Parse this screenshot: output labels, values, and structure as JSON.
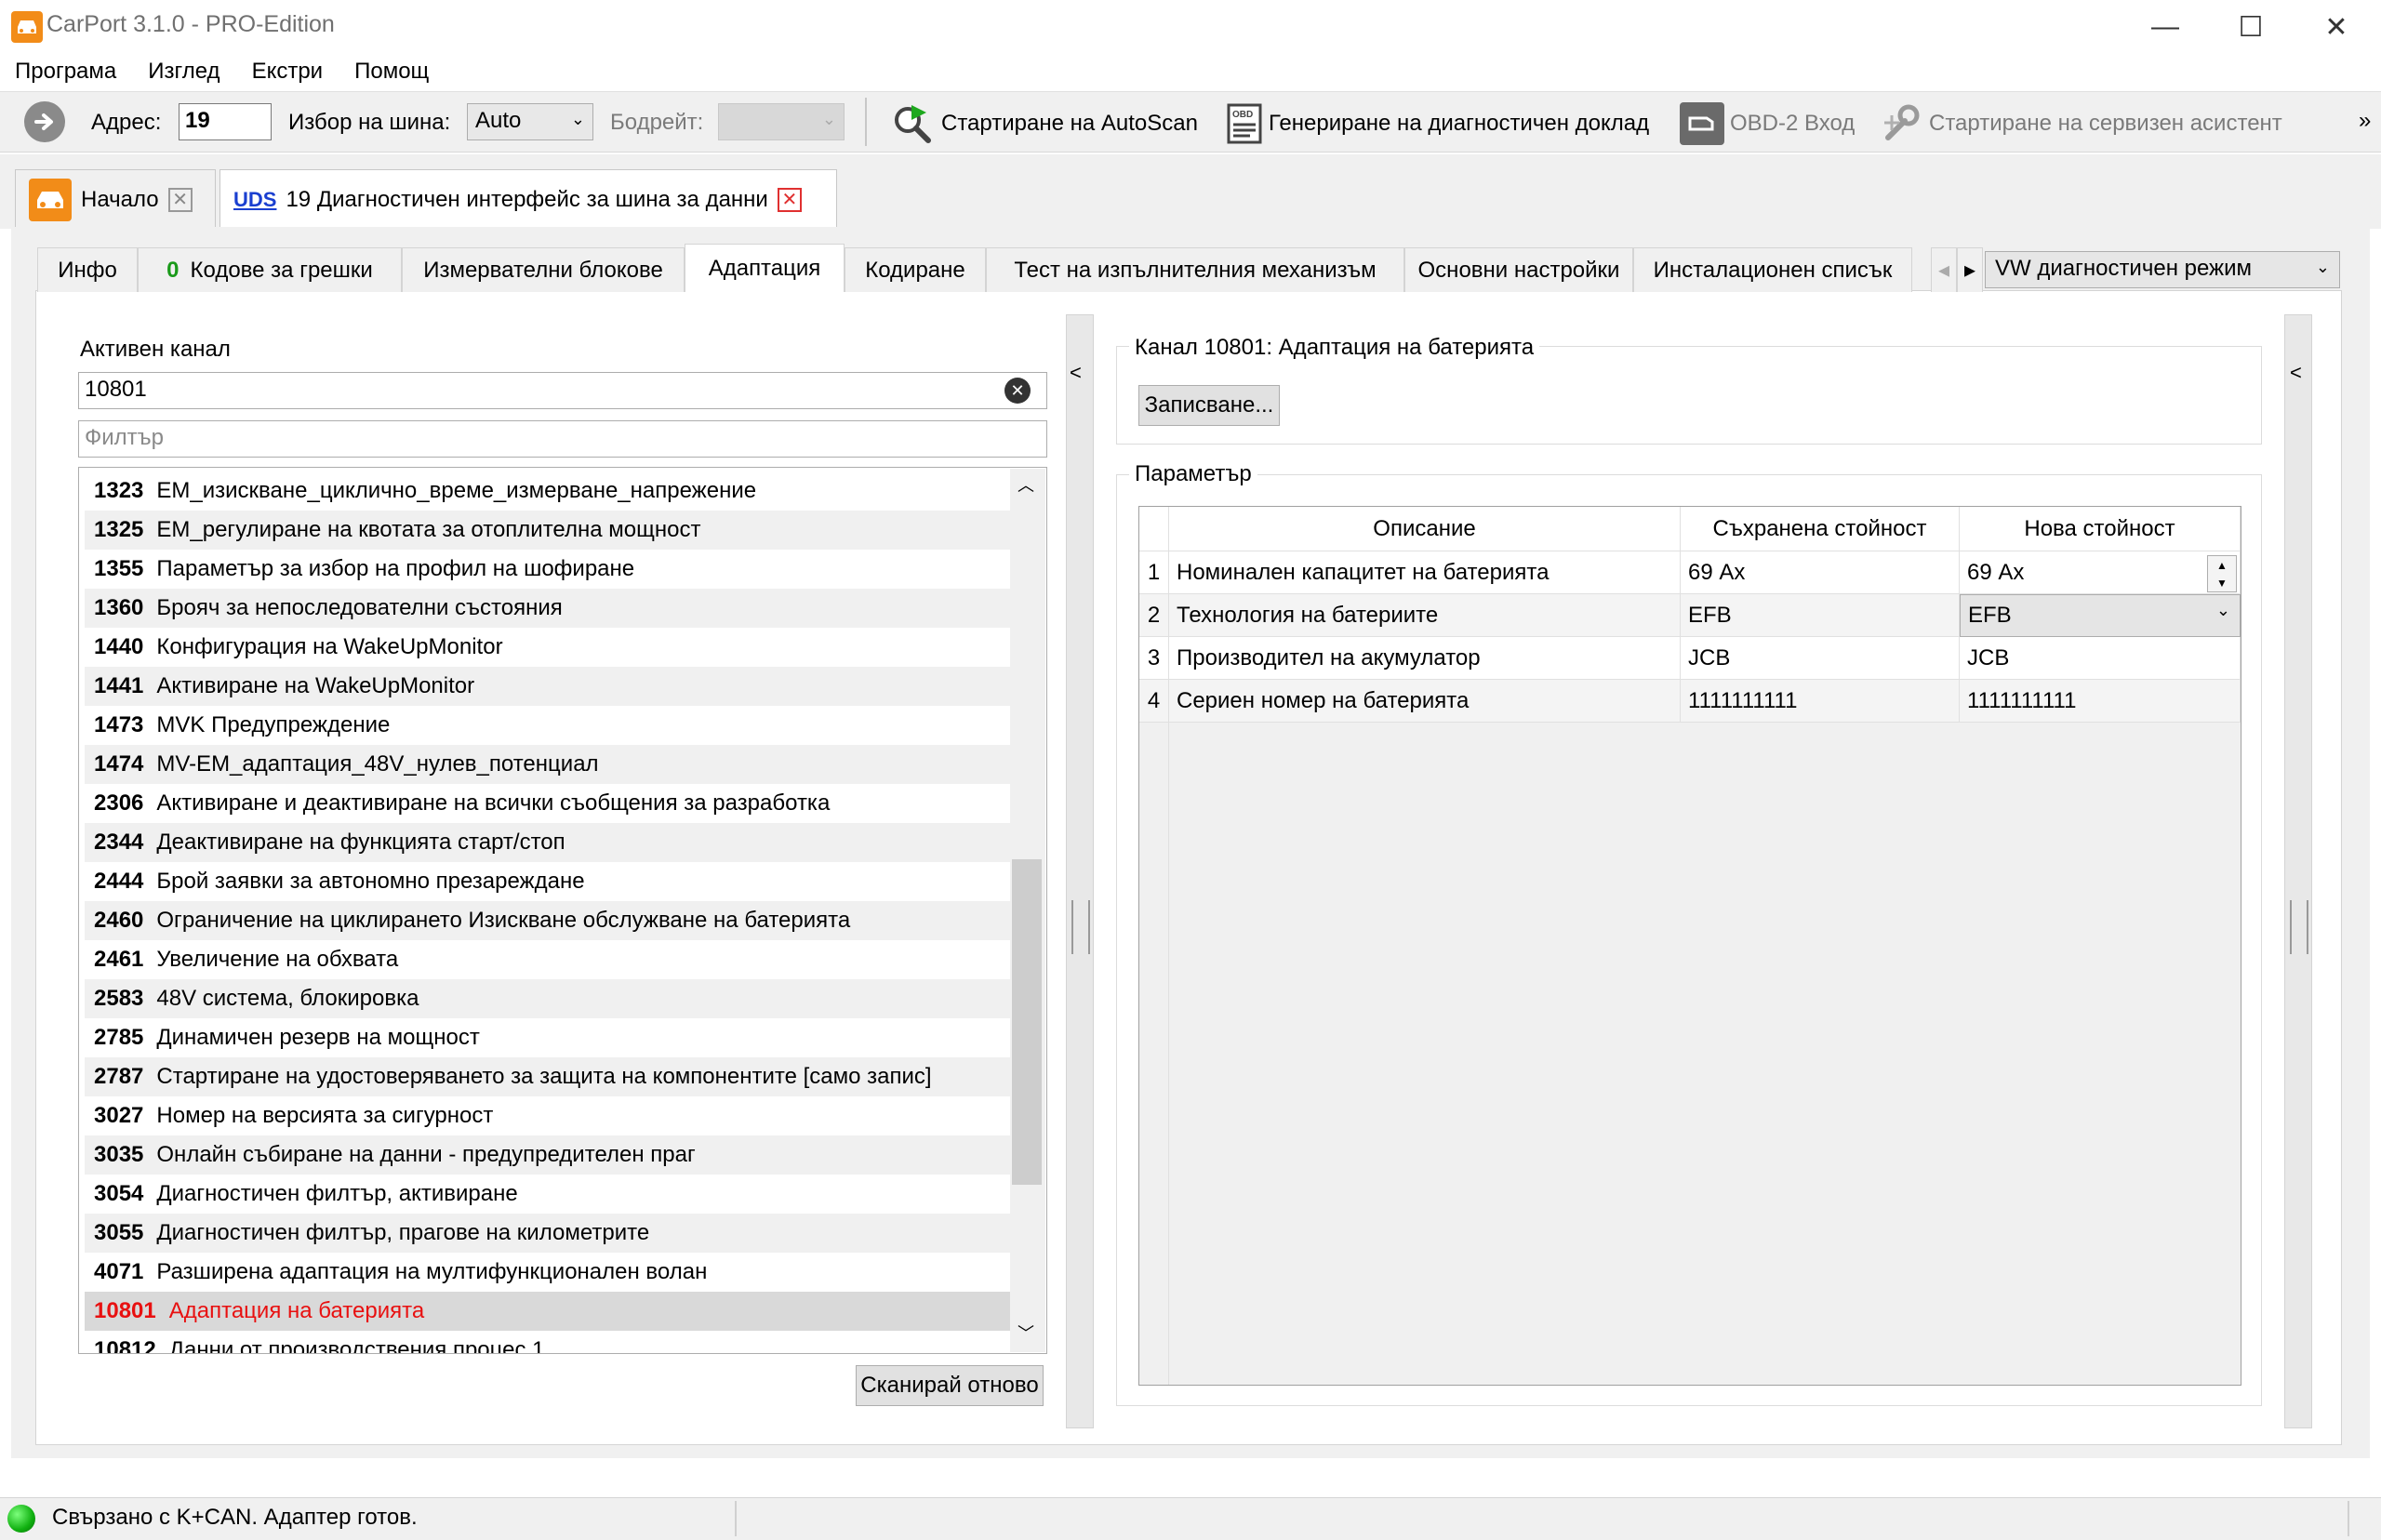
{
  "window": {
    "title": "CarPort 3.1.0 - PRO-Edition",
    "controls": [
      "—",
      "☐",
      "✕"
    ]
  },
  "menu": [
    "Програма",
    "Изглед",
    "Екстри",
    "Помощ"
  ],
  "toolbar": {
    "address_label": "Адрес:",
    "address_value": "19",
    "bus_label": "Избор на шина:",
    "bus_value": "Auto",
    "baud_label": "Бодрейт:",
    "autoscan": "Стартиране на AutoScan",
    "report": "Генериране на диагностичен доклад",
    "obd_input": "OBD-2 Вход",
    "service": "Стартиране на сервизен асистент",
    "more": "»"
  },
  "doc_tabs": [
    {
      "label": "Начало"
    },
    {
      "badge": "UDS",
      "label": "19 Диагностичен интерфейс за шина за данни"
    }
  ],
  "sub_tabs": {
    "info": "Инфо",
    "faults_count": "0",
    "faults": "Кодове за грешки",
    "measure": "Измервателни блокове",
    "adapt": "Адаптация",
    "coding": "Кодиране",
    "actuator": "Тест на изпълнителния механизъм",
    "basic": "Основни настройки",
    "install": "Инсталационен списък",
    "mode": "VW диагностичен режим"
  },
  "left": {
    "active_label": "Активен канал",
    "active_value": "10801",
    "filter_placeholder": "Филтър",
    "rescan": "Сканирай отново",
    "channels": [
      {
        "num": "1323",
        "name": "EM_изискване_циклично_време_измерване_напрежение"
      },
      {
        "num": "1325",
        "name": "EM_регулиране на квотата за отоплителна мощност"
      },
      {
        "num": "1355",
        "name": "Параметър за избор на профил на шофиране"
      },
      {
        "num": "1360",
        "name": "Брояч за непоследователни състояния"
      },
      {
        "num": "1440",
        "name": "Конфигурация на WakeUpMonitor"
      },
      {
        "num": "1441",
        "name": "Активиране на WakeUpMonitor"
      },
      {
        "num": "1473",
        "name": "MVK Предупреждение"
      },
      {
        "num": "1474",
        "name": "MV-EM_адаптация_48V_нулев_потенциал"
      },
      {
        "num": "2306",
        "name": "Активиране и деактивиране на всички съобщения за разработка"
      },
      {
        "num": "2344",
        "name": "Деактивиране на функцията старт/стоп"
      },
      {
        "num": "2444",
        "name": "Брой заявки за автономно презареждане"
      },
      {
        "num": "2460",
        "name": "Ограничение на циклирането Изискване обслужване на батерията"
      },
      {
        "num": "2461",
        "name": "Увеличение на обхвата"
      },
      {
        "num": "2583",
        "name": "48V система, блокировка"
      },
      {
        "num": "2785",
        "name": "Динамичен резерв на мощност"
      },
      {
        "num": "2787",
        "name": "Стартиране на удостоверяването за защита на компонентите [само запис]"
      },
      {
        "num": "3027",
        "name": "Номер на версията за сигурност"
      },
      {
        "num": "3035",
        "name": "Онлайн събиране на данни - предупредителен праг"
      },
      {
        "num": "3054",
        "name": "Диагностичен филтър, активиране"
      },
      {
        "num": "3055",
        "name": "Диагностичен филтър, прагове на километрите"
      },
      {
        "num": "4071",
        "name": "Разширена адаптация на мултифункционален волан"
      },
      {
        "num": "10801",
        "name": "Адаптация на батерията"
      },
      {
        "num": "10812",
        "name": "Данни от производствения процес 1"
      }
    ]
  },
  "right": {
    "channel_title": "Канал 10801: Адаптация на батерията",
    "write_button": "Записване...",
    "param_title": "Параметър",
    "columns": [
      "Описание",
      "Съхранена стойност",
      "Нова стойност"
    ],
    "rows": [
      {
        "n": "1",
        "desc": "Номинален капацитет на батерията",
        "stored": "69 Ах",
        "new": "69 Ах"
      },
      {
        "n": "2",
        "desc": "Технология на батериите",
        "stored": "EFB",
        "new": "EFB"
      },
      {
        "n": "3",
        "desc": "Производител на акумулатор",
        "stored": "JCB",
        "new": "JCB"
      },
      {
        "n": "4",
        "desc": "Сериен номер на батерията",
        "stored": "1111111111",
        "new": "1111111111"
      }
    ]
  },
  "status": {
    "text": "Свързано с K+CAN. Адаптер готов."
  },
  "colors": {
    "accent_orange": "#f28c18",
    "selected_text": "#e81010",
    "status_led": "#10b010",
    "fault_count": "#1a9a1a"
  }
}
